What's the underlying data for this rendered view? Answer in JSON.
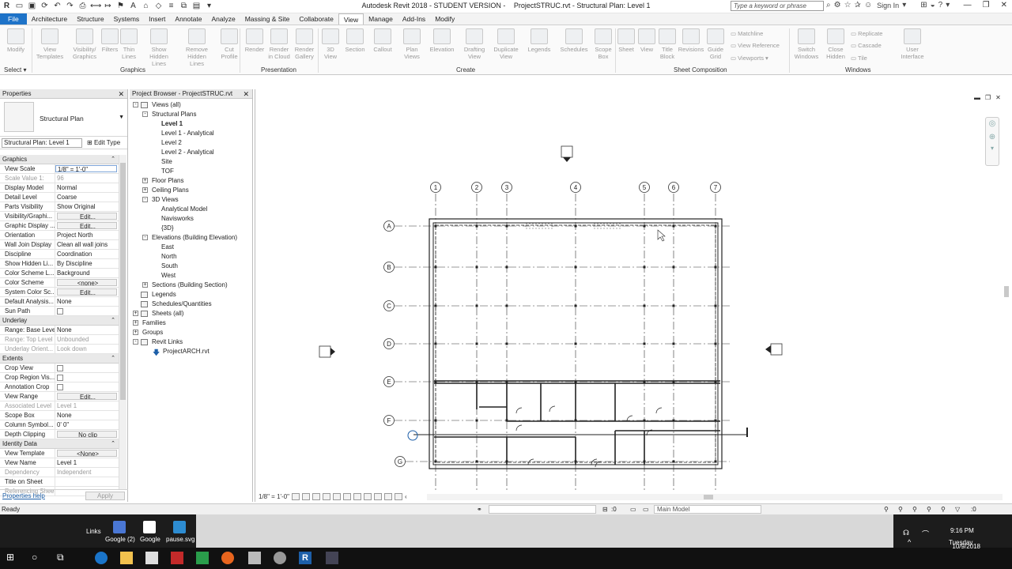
{
  "titlebar": {
    "app": "Autodesk Revit 2018 - STUDENT VERSION -",
    "file": "ProjectSTRUC.rvt - Structural Plan: Level 1",
    "search_placeholder": "Type a keyword or phrase",
    "signin": "Sign In"
  },
  "tabs": [
    "File",
    "Architecture",
    "Structure",
    "Systems",
    "Insert",
    "Annotate",
    "Analyze",
    "Massing & Site",
    "Collaborate",
    "View",
    "Manage",
    "Add-Ins",
    "Modify"
  ],
  "active_tab": "View",
  "ribbon": {
    "modify": "Modify",
    "select": "Select",
    "view_templates": [
      "View",
      "Templates"
    ],
    "visibility_graphics": [
      "Visibility/",
      "Graphics"
    ],
    "filters": "Filters",
    "thin_lines": [
      "Thin",
      "Lines"
    ],
    "show_hidden_lines": [
      "Show",
      "Hidden Lines"
    ],
    "remove_hidden_lines": [
      "Remove",
      "Hidden Lines"
    ],
    "cut_profile": [
      "Cut",
      "Profile"
    ],
    "render": "Render",
    "render_in_cloud": [
      "Render",
      "in Cloud"
    ],
    "render_gallery": [
      "Render",
      "Gallery"
    ],
    "view_3d": [
      "3D",
      "View"
    ],
    "section": "Section",
    "callout": "Callout",
    "plan_views": [
      "Plan",
      "Views"
    ],
    "elevation": "Elevation",
    "drafting_view": [
      "Drafting",
      "View"
    ],
    "duplicate_view": [
      "Duplicate",
      "View"
    ],
    "legends": "Legends",
    "schedules": "Schedules",
    "scope_box": [
      "Scope",
      "Box"
    ],
    "sheet": "Sheet",
    "view": "View",
    "title_block": [
      "Title",
      "Block"
    ],
    "revisions": "Revisions",
    "guide_grid": [
      "Guide",
      "Grid"
    ],
    "matchline": "Matchline",
    "view_reference": "View Reference",
    "viewports": "Viewports",
    "switch_windows": [
      "Switch",
      "Windows"
    ],
    "close_hidden": [
      "Close",
      "Hidden"
    ],
    "replicate": "Replicate",
    "cascade": "Cascade",
    "tile": "Tile",
    "user_interface": [
      "User",
      "Interface"
    ],
    "panels": {
      "graphics": "Graphics",
      "presentation": "Presentation",
      "create": "Create",
      "sheet_composition": "Sheet Composition",
      "windows": "Windows"
    }
  },
  "properties": {
    "title": "Properties",
    "type_name": "Structural Plan",
    "instance": "Structural Plan: Level 1",
    "edit_type": "Edit Type",
    "sections": [
      {
        "name": "Graphics",
        "rows": [
          {
            "k": "View Scale",
            "v": "1/8\" = 1'-0\"",
            "kind": "input"
          },
          {
            "k": "Scale Value    1:",
            "v": "96",
            "kind": "grey"
          },
          {
            "k": "Display Model",
            "v": "Normal"
          },
          {
            "k": "Detail Level",
            "v": "Coarse"
          },
          {
            "k": "Parts Visibility",
            "v": "Show Original"
          },
          {
            "k": "Visibility/Graphi...",
            "v": "Edit...",
            "kind": "btn"
          },
          {
            "k": "Graphic Display ...",
            "v": "Edit...",
            "kind": "btn"
          },
          {
            "k": "Orientation",
            "v": "Project North"
          },
          {
            "k": "Wall Join Display",
            "v": "Clean all wall joins"
          },
          {
            "k": "Discipline",
            "v": "Coordination"
          },
          {
            "k": "Show Hidden Li...",
            "v": "By Discipline"
          },
          {
            "k": "Color Scheme L...",
            "v": "Background"
          },
          {
            "k": "Color Scheme",
            "v": "<none>",
            "kind": "btn"
          },
          {
            "k": "System Color Sc...",
            "v": "Edit...",
            "kind": "btn"
          },
          {
            "k": "Default Analysis...",
            "v": "None"
          },
          {
            "k": "Sun Path",
            "v": "",
            "kind": "cb"
          }
        ]
      },
      {
        "name": "Underlay",
        "rows": [
          {
            "k": "Range: Base Level",
            "v": "None"
          },
          {
            "k": "Range: Top Level",
            "v": "Unbounded",
            "kind": "grey"
          },
          {
            "k": "Underlay Orient...",
            "v": "Look down",
            "kind": "grey"
          }
        ]
      },
      {
        "name": "Extents",
        "rows": [
          {
            "k": "Crop View",
            "v": "",
            "kind": "cb"
          },
          {
            "k": "Crop Region Vis...",
            "v": "",
            "kind": "cb"
          },
          {
            "k": "Annotation Crop",
            "v": "",
            "kind": "cb"
          },
          {
            "k": "View Range",
            "v": "Edit...",
            "kind": "btn"
          },
          {
            "k": "Associated Level",
            "v": "Level 1",
            "kind": "grey"
          },
          {
            "k": "Scope Box",
            "v": "None"
          },
          {
            "k": "Column Symbol...",
            "v": "0'  0\""
          },
          {
            "k": "Depth Clipping",
            "v": "No clip",
            "kind": "btn"
          }
        ]
      },
      {
        "name": "Identity Data",
        "rows": [
          {
            "k": "View Template",
            "v": "<None>",
            "kind": "btn"
          },
          {
            "k": "View Name",
            "v": "Level 1"
          },
          {
            "k": "Dependency",
            "v": "Independent",
            "kind": "grey"
          },
          {
            "k": "Title on Sheet",
            "v": ""
          },
          {
            "k": "Referencing Sheet",
            "v": "",
            "kind": "grey"
          }
        ]
      }
    ],
    "help": "Properties help",
    "apply": "Apply"
  },
  "browser": {
    "title": "Project Browser - ProjectSTRUC.rvt",
    "items": [
      {
        "label": "Views (all)",
        "level": 0,
        "tog": "-",
        "icon": "views"
      },
      {
        "label": "Structural Plans",
        "level": 1,
        "tog": "-"
      },
      {
        "label": "Level 1",
        "level": 2,
        "bold": true
      },
      {
        "label": "Level 1 - Analytical",
        "level": 2
      },
      {
        "label": "Level 2",
        "level": 2
      },
      {
        "label": "Level 2 - Analytical",
        "level": 2
      },
      {
        "label": "Site",
        "level": 2
      },
      {
        "label": "TOF",
        "level": 2
      },
      {
        "label": "Floor Plans",
        "level": 1,
        "tog": "+"
      },
      {
        "label": "Ceiling Plans",
        "level": 1,
        "tog": "+"
      },
      {
        "label": "3D Views",
        "level": 1,
        "tog": "-"
      },
      {
        "label": "Analytical Model",
        "level": 2
      },
      {
        "label": "Navisworks",
        "level": 2
      },
      {
        "label": "{3D}",
        "level": 2
      },
      {
        "label": "Elevations (Building Elevation)",
        "level": 1,
        "tog": "-"
      },
      {
        "label": "East",
        "level": 2
      },
      {
        "label": "North",
        "level": 2
      },
      {
        "label": "South",
        "level": 2
      },
      {
        "label": "West",
        "level": 2
      },
      {
        "label": "Sections (Building Section)",
        "level": 1,
        "tog": "+"
      },
      {
        "label": "Legends",
        "level": 0,
        "icon": "legend"
      },
      {
        "label": "Schedules/Quantities",
        "level": 0,
        "icon": "sched"
      },
      {
        "label": "Sheets (all)",
        "level": 0,
        "tog": "+",
        "icon": "sheet"
      },
      {
        "label": "Families",
        "level": 0,
        "tog": "+"
      },
      {
        "label": "Groups",
        "level": 0,
        "tog": "+"
      },
      {
        "label": "Revit Links",
        "level": 0,
        "tog": "-",
        "icon": "links"
      },
      {
        "label": "ProjectARCH.rvt",
        "level": 1,
        "icon": "link"
      }
    ]
  },
  "drawing": {
    "grid_cols": [
      "1",
      "2",
      "3",
      "4",
      "5",
      "6",
      "7"
    ],
    "grid_rows": [
      "A",
      "B",
      "C",
      "D",
      "E",
      "F",
      "G"
    ],
    "scale_label": "1/8\" = 1'-0\""
  },
  "status": {
    "ready": "Ready",
    "sel_count": ":0",
    "model": "Main Model",
    "filter_count": ":0"
  },
  "desktop": {
    "links_title": "Links",
    "icons": [
      "Google (2)",
      "Google",
      "pause.svg"
    ]
  },
  "tray": {
    "time": "9:16 PM",
    "day": "Tuesday",
    "date": "10/9/2018"
  },
  "colors": {
    "file_tab": "#1e73c8",
    "link": "#1d5fa8",
    "grid_bubble": "#333333"
  }
}
